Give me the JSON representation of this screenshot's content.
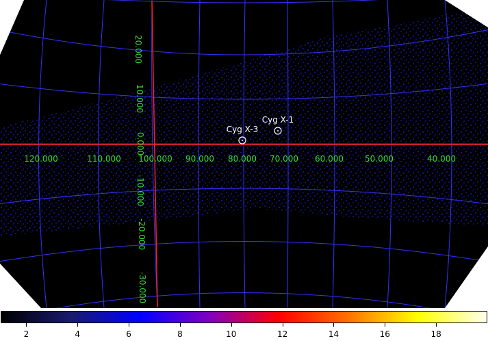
{
  "image": {
    "background": "#000000",
    "outside_color": "#ffffff",
    "grid_color": "#3333ff",
    "axis_color": "#ff2020",
    "axis_label_color": "#33dd33",
    "source_color": "#ffffff"
  },
  "grid": {
    "longitude_labels": [
      "120.000",
      "110.000",
      "100.000",
      "90.000",
      "80.000",
      "70.000",
      "60.000",
      "50.000",
      "40.000"
    ],
    "latitude_labels": [
      "20.000",
      "10.000",
      "0.000",
      "-10.000",
      "-20.000",
      "-30.000"
    ]
  },
  "regions": [
    {
      "label": "Cyg X-3",
      "icon": "circle-region-icon"
    },
    {
      "label": "Cyg X-1",
      "icon": "circle-region-icon"
    }
  ],
  "colorbar": {
    "gradient": [
      "#000000",
      "#1a1a6e",
      "#0000ff",
      "#8000c0",
      "#ff0000",
      "#ff7000",
      "#ffff00",
      "#fffff0"
    ],
    "min": 1,
    "max": 19,
    "tick_labels": [
      "2",
      "4",
      "6",
      "8",
      "10",
      "12",
      "14",
      "16",
      "18"
    ]
  }
}
